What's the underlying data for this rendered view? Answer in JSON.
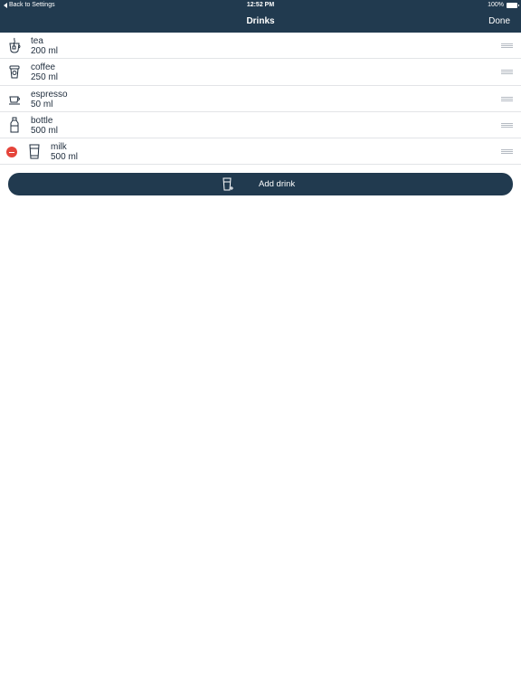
{
  "status_bar": {
    "back_label": "Back to Settings",
    "time": "12:52 PM",
    "battery": "100%"
  },
  "nav": {
    "title": "Drinks",
    "done_label": "Done"
  },
  "drinks": [
    {
      "name": "tea",
      "volume": "200 ml",
      "icon": "tea-cup-icon"
    },
    {
      "name": "coffee",
      "volume": "250 ml",
      "icon": "coffee-cup-icon"
    },
    {
      "name": "espresso",
      "volume": "50 ml",
      "icon": "espresso-cup-icon"
    },
    {
      "name": "bottle",
      "volume": "500 ml",
      "icon": "bottle-icon"
    },
    {
      "name": "milk",
      "volume": "500 ml",
      "icon": "glass-icon"
    }
  ],
  "add_button": {
    "label": "Add drink",
    "icon": "add-glass-icon"
  },
  "colors": {
    "header_bg": "#213a4f",
    "delete_red": "#e5453b",
    "separator": "#e2e4e7"
  }
}
